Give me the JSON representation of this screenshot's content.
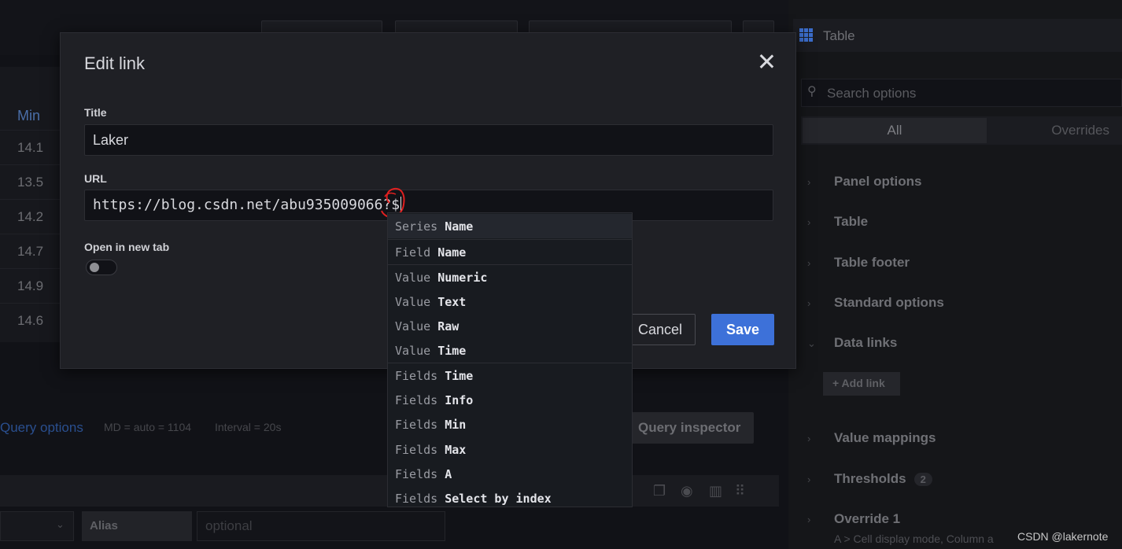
{
  "background": {
    "grid": {
      "header": "Min",
      "rows": [
        "14.1",
        "13.5",
        "14.2",
        "14.7",
        "14.9",
        "14.6"
      ]
    },
    "query_options": {
      "label": "Query options",
      "md": "MD = auto = 1104",
      "interval": "Interval = 20s",
      "inspector": "Query inspector"
    },
    "query": {
      "alias_label": "Alias",
      "alias_placeholder": "optional"
    }
  },
  "options_pane": {
    "visualization": "Table",
    "search_placeholder": "Search options",
    "tabs": {
      "all": "All",
      "overrides": "Overrides"
    },
    "sections": [
      {
        "label": "Panel options"
      },
      {
        "label": "Table"
      },
      {
        "label": "Table footer"
      },
      {
        "label": "Standard options"
      },
      {
        "label": "Data links"
      },
      {
        "label": "Value mappings"
      },
      {
        "label": "Thresholds",
        "badge": "2"
      },
      {
        "label": "Override 1"
      }
    ],
    "add_link": "Add link",
    "override_desc": "A  >  Cell display mode, Column a"
  },
  "modal": {
    "title": "Edit link",
    "title_label": "Title",
    "title_value": "Laker",
    "url_label": "URL",
    "url_value": "https://blog.csdn.net/abu935009066?$",
    "new_tab_label": "Open in new tab",
    "new_tab_checked": false,
    "cancel_label": "Cancel",
    "save_label": "Save"
  },
  "suggestions": [
    {
      "category": "Series",
      "name": "Name"
    },
    {
      "category": "Field",
      "name": "Name"
    },
    {
      "category": "Value",
      "name": "Numeric"
    },
    {
      "category": "Value",
      "name": "Text"
    },
    {
      "category": "Value",
      "name": "Raw"
    },
    {
      "category": "Value",
      "name": "Time"
    },
    {
      "category": "Fields",
      "name": "Time"
    },
    {
      "category": "Fields",
      "name": "Info"
    },
    {
      "category": "Fields",
      "name": "Min"
    },
    {
      "category": "Fields",
      "name": "Max"
    },
    {
      "category": "Fields",
      "name": "A"
    },
    {
      "category": "Fields",
      "name": "Select by index"
    }
  ],
  "watermark": "CSDN @lakernote",
  "colors": {
    "accent": "#3d71d9",
    "annotation": "#e02020"
  }
}
